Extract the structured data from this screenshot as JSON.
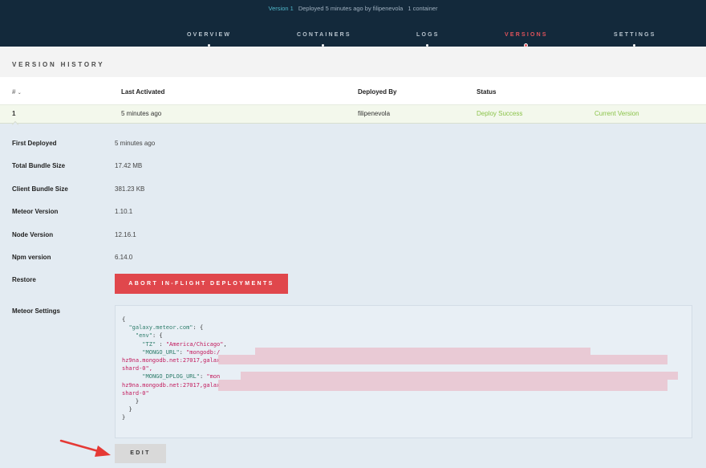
{
  "header": {
    "version_label": "Version 1",
    "deployed_text": "Deployed 5 minutes ago by filipenevola",
    "container_text": "1 container"
  },
  "tabs": [
    {
      "label": "OVERVIEW",
      "active": false
    },
    {
      "label": "CONTAINERS",
      "active": false
    },
    {
      "label": "LOGS",
      "active": false
    },
    {
      "label": "VERSIONS",
      "active": true
    },
    {
      "label": "SETTINGS",
      "active": false
    }
  ],
  "section_title": "VERSION HISTORY",
  "table": {
    "headers": {
      "hash": "#",
      "last_activated": "Last Activated",
      "deployed_by": "Deployed By",
      "status": "Status"
    },
    "row": {
      "number": "1",
      "last_activated": "5 minutes ago",
      "deployed_by": "filipenevola",
      "status": "Deploy Success",
      "current": "Current Version"
    }
  },
  "details": [
    {
      "label": "First Deployed",
      "value": "5 minutes ago"
    },
    {
      "label": "Total Bundle Size",
      "value": "17.42 MB"
    },
    {
      "label": "Client Bundle Size",
      "value": "381.23 KB"
    },
    {
      "label": "Meteor Version",
      "value": "1.10.1"
    },
    {
      "label": "Node Version",
      "value": "12.16.1"
    },
    {
      "label": "Npm version",
      "value": "6.14.0"
    }
  ],
  "restore": {
    "label": "Restore",
    "button": "ABORT IN-FLIGHT DEPLOYMENTS"
  },
  "settings": {
    "label": "Meteor Settings",
    "code": {
      "l1": "{",
      "l2_key": "\"galaxy.meteor.com\"",
      "l2_rest": ": {",
      "l3_key": "\"env\"",
      "l3_rest": ": {",
      "l4_key": "\"TZ\"",
      "l4_sep": " : ",
      "l4_val": "\"America/Chicago\"",
      "l4_end": ",",
      "l5_key": "\"MONGO_URL\"",
      "l5_sep": ": ",
      "l5_val": "\"mongodb:/",
      "l6": "hz9na.mongodb.net:27017,galax",
      "l7": "shard-0\",",
      "l8_key": "\"MONGO_DPLOG_URL\"",
      "l8_sep": ": ",
      "l8_val": "\"mon",
      "l9": "hz9na.mongodb.net:27017,galax",
      "l10": "shard-0\"",
      "l11": "}",
      "l12": "}",
      "l13": "}"
    },
    "edit_button": "EDIT"
  },
  "colors": {
    "accent": "#e0474c",
    "success": "#8bc34a",
    "header_bg": "#13293b",
    "version_link": "#4fb6c9"
  }
}
